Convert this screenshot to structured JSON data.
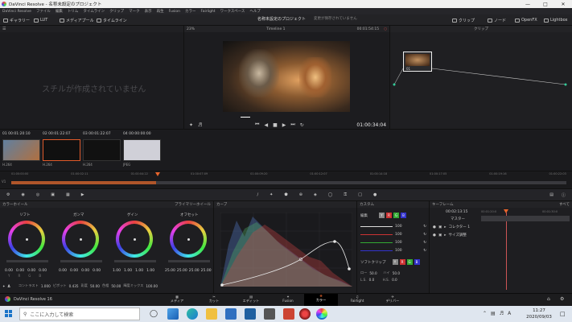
{
  "window": {
    "title": "DaVinci Resolve - 名称未設定のプロジェクト"
  },
  "menu": [
    "DaVinci Resolve",
    "ファイル",
    "編集",
    "トリム",
    "タイムライン",
    "クリップ",
    "マーク",
    "表示",
    "再生",
    "Fusion",
    "カラー",
    "Fairlight",
    "ワークスペース",
    "ヘルプ"
  ],
  "toolbar": {
    "gallery": "ギャラリー",
    "lut": "LUT",
    "media_pool": "メディアプール",
    "timelines": "タイムライン",
    "project_title": "名称未設定のプロジェクト",
    "project_status": "変更が保存されていません",
    "zoom": "23%",
    "timeline_name": "Timeline 1",
    "timecode_top": "00:01:54:15",
    "clip_menu": "クリップ",
    "node_menu": "ノード",
    "openfx": "OpenFX",
    "lightbox": "Lightbox"
  },
  "gallery": {
    "empty_text": "スチルが作成されていません"
  },
  "viewer": {
    "timecode": "01:00:34:04"
  },
  "nodes": {
    "header": "クリップ",
    "node_label": "01"
  },
  "clips": [
    {
      "num": "01",
      "tc": "00:01:20:10",
      "codec": "H.264",
      "color": "#4a6a8a"
    },
    {
      "num": "02",
      "tc": "00:01:22:07",
      "codec": "H.264",
      "color": "#101010"
    },
    {
      "num": "03",
      "tc": "00:01:22:07",
      "codec": "H.264",
      "color": "#111111"
    },
    {
      "num": "04",
      "tc": "00:00:00:00",
      "codec": "JPEG",
      "color": "#cfcfd6"
    }
  ],
  "mini_timeline": [
    "01:00:00:00",
    "01:00:02:11",
    "01:00:04:22",
    "01:00:07:09",
    "01:00:09:20",
    "01:00:12:07",
    "01:00:14:18",
    "01:00:17:05",
    "01:00:19:16",
    "01:00:22:03"
  ],
  "wheels": {
    "header": "カラーホイール",
    "mode": "プライマリーホイール",
    "items": [
      {
        "label": "リフト",
        "vals": [
          "0.00",
          "0.00",
          "0.00",
          "0.00"
        ]
      },
      {
        "label": "ガンマ",
        "vals": [
          "0.00",
          "0.00",
          "0.00",
          "0.00"
        ]
      },
      {
        "label": "ゲイン",
        "vals": [
          "1.00",
          "1.00",
          "1.00",
          "1.00"
        ]
      },
      {
        "label": "オフセット",
        "vals": [
          "25.00",
          "25.00",
          "25.00",
          "25.00"
        ]
      }
    ],
    "channels": [
      "Y",
      "R",
      "G",
      "B"
    ],
    "bottom": {
      "contrast_label": "コントラスト",
      "contrast": "1.000",
      "pivot_label": "ピボット",
      "pivot": "0.435",
      "sat_label": "彩度",
      "sat": "50.00",
      "hue_label": "色相",
      "hue": "50.00",
      "lum_label": "輝度ミックス",
      "lum": "100.00"
    }
  },
  "curves": {
    "header": "カーブ"
  },
  "custom": {
    "header": "カスタム",
    "edit_label": "編集",
    "channel_letters": [
      "Y",
      "R",
      "G",
      "B"
    ],
    "values": [
      "100",
      "100",
      "100",
      "100"
    ],
    "soft_clip": "ソフトクリップ",
    "low_label": "ロー",
    "low": "50.0",
    "high_label": "ハイ",
    "high": "50.0",
    "ls_label": "L.S.",
    "ls": "0.0",
    "hs_label": "H.S.",
    "hs": "0.0"
  },
  "keyframes": {
    "header": "キーフレーム",
    "filter": "すべて",
    "timecode": "00:02:13:15",
    "tc_left": "00:01:20:0",
    "tc_right": "00:01:30:0",
    "master": "マスター",
    "tracks": [
      "コレクター 1",
      "サイズ調整"
    ]
  },
  "pages": [
    "メディア",
    "カット",
    "エディット",
    "Fusion",
    "カラー",
    "Fairlight",
    "デリバー"
  ],
  "app_name": "DaVinci Resolve 16",
  "taskbar": {
    "search_placeholder": "ここに入力して検索",
    "time": "11:27",
    "date": "2020/09/03"
  }
}
